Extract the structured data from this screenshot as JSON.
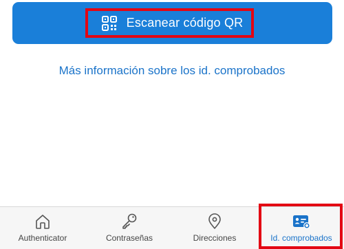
{
  "scan_button": {
    "label": "Escanear código QR",
    "icon": "qr-code-icon"
  },
  "info_link": {
    "text": "Más información sobre los id. comprobados"
  },
  "tab_bar": {
    "tabs": [
      {
        "label": "Authenticator",
        "icon": "home-icon",
        "active": false
      },
      {
        "label": "Contraseñas",
        "icon": "key-icon",
        "active": false
      },
      {
        "label": "Direcciones",
        "icon": "location-pin-icon",
        "active": false
      },
      {
        "label": "Id. comprobados",
        "icon": "id-card-icon",
        "active": true
      }
    ]
  },
  "colors": {
    "accent": "#1a7fd9",
    "link": "#1a73c9",
    "highlight": "#e30613",
    "tab_bar_background": "#f6f6f6"
  }
}
